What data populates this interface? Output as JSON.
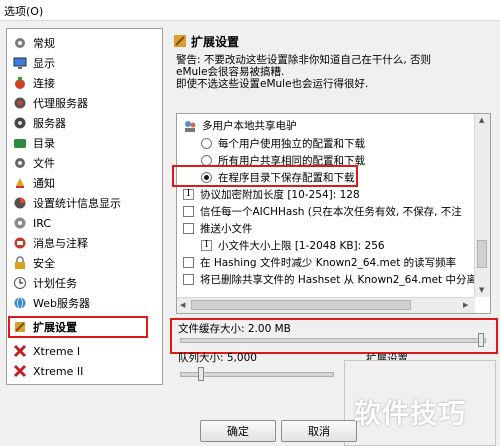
{
  "window": {
    "title": "选项(O)"
  },
  "sidebar": {
    "items": [
      {
        "label": "常规",
        "icon": "gear-icon"
      },
      {
        "label": "显示",
        "icon": "display-icon"
      },
      {
        "label": "连接",
        "icon": "plug-icon"
      },
      {
        "label": "代理服务器",
        "icon": "proxy-icon"
      },
      {
        "label": "服务器",
        "icon": "server-icon"
      },
      {
        "label": "目录",
        "icon": "folder-icon"
      },
      {
        "label": "文件",
        "icon": "file-icon"
      },
      {
        "label": "通知",
        "icon": "bell-icon"
      },
      {
        "label": "设置统计信息显示",
        "icon": "stats-icon"
      },
      {
        "label": "IRC",
        "icon": "irc-icon"
      },
      {
        "label": "消息与注释",
        "icon": "message-icon"
      },
      {
        "label": "安全",
        "icon": "lock-icon"
      },
      {
        "label": "计划任务",
        "icon": "clock-icon"
      },
      {
        "label": "Web服务器",
        "icon": "web-icon"
      },
      {
        "label": "扩展设置",
        "icon": "tools-icon",
        "selected": true
      },
      {
        "label": "Xtreme I",
        "icon": "xtreme-icon"
      },
      {
        "label": "Xtreme II",
        "icon": "xtreme-icon"
      }
    ]
  },
  "panel": {
    "title": "扩展设置",
    "warning_lines": [
      "警告: 不要改动这些设置除非你知道自己在干什么, 否则",
      "eMule会很容易被搞糟.",
      "即使不选这些设置eMule也会运行得很好."
    ],
    "tree": {
      "group_label": "多用户本地共享电驴",
      "radio_options": [
        "每个用户使用独立的配置和下载",
        "所有用户共享相同的配置和下载",
        "在程序目录下保存配置和下载"
      ],
      "selected_radio": 2,
      "row_protocol": "协议加密附加长度 [10-254]: 128",
      "row_trust": "信任每一个AICHHash (只在本次任务有效, 不保存, 不注",
      "row_push": "推送小文件",
      "row_push_limit": "小文件大小上限 [1-2048 KB]: 256",
      "row_hashing": "在 Hashing 文件时减少 Known2_64.met 的读写频率",
      "row_delete_hashset": "将已删除共享文件的 Hashset 从 Known2_64.met 中分离"
    },
    "file_buffer_label": "文件缓存大小: 2.00 MB",
    "file_buffer_level": 1.0,
    "queue_label": "队列大小: 5,000",
    "queue_level": 0.12,
    "ext_group_label": "扩展设置"
  },
  "buttons": {
    "ok": "确定",
    "cancel": "取消"
  },
  "watermark": "软件技巧",
  "colors": {
    "highlight": "#e01818",
    "panel_bg": "#f0f0f0",
    "tree_bg": "#ffffff"
  }
}
